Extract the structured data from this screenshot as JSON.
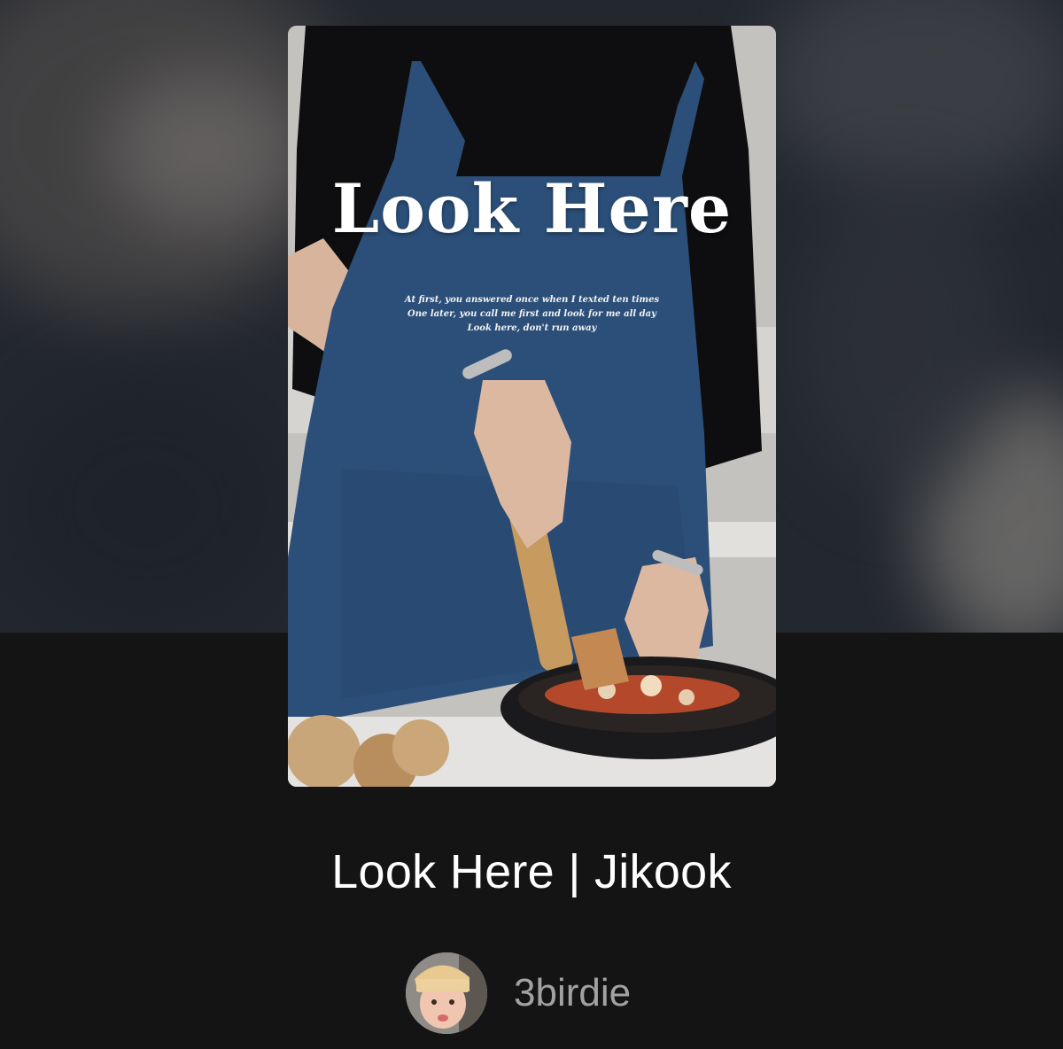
{
  "cover": {
    "title": "Look Here",
    "lyrics": [
      "At first, you answered once when I texted ten times",
      "One later, you call me first and look for me all day",
      "Look here, don't run away"
    ]
  },
  "story": {
    "title": "Look Here | Jikook"
  },
  "author": {
    "name": "3birdie"
  },
  "colors": {
    "page_background": "#141414",
    "title_text": "#ffffff",
    "author_text": "#a2a2a2"
  }
}
